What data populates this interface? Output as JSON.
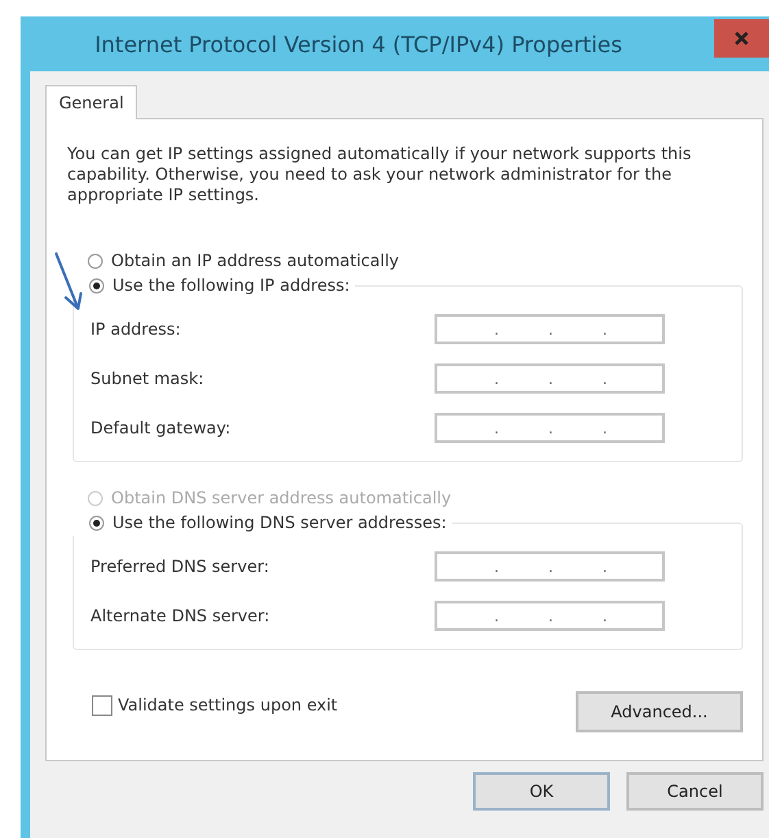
{
  "window": {
    "title": "Internet Protocol Version 4 (TCP/IPv4) Properties"
  },
  "tabs": [
    {
      "label": "General",
      "selected": true
    }
  ],
  "intro": "You can get IP settings assigned automatically if your network supports this capability. Otherwise, you need to ask your network administrator for the appropriate IP settings.",
  "sections": [
    {
      "options": [
        {
          "label": "Obtain an IP address automatically",
          "selected": false,
          "disabled": false
        },
        {
          "label": "Use the following IP address:",
          "selected": true,
          "disabled": false
        }
      ],
      "fields": [
        {
          "label": "IP address:",
          "separators": [
            ".",
            ".",
            "."
          ]
        },
        {
          "label": "Subnet mask:",
          "separators": [
            ".",
            ".",
            "."
          ]
        },
        {
          "label": "Default gateway:",
          "separators": [
            ".",
            ".",
            "."
          ]
        }
      ]
    },
    {
      "options": [
        {
          "label": "Obtain DNS server address automatically",
          "selected": false,
          "disabled": true
        },
        {
          "label": "Use the following DNS server addresses:",
          "selected": true,
          "disabled": false
        }
      ],
      "fields": [
        {
          "label": "Preferred DNS server:",
          "separators": [
            ".",
            ".",
            "."
          ]
        },
        {
          "label": "Alternate DNS server:",
          "separators": [
            ".",
            ".",
            "."
          ]
        }
      ]
    }
  ],
  "validate": {
    "label": "Validate settings upon exit",
    "checked": false
  },
  "advanced_button": "Advanced...",
  "buttons": [
    "OK",
    "Cancel"
  ]
}
